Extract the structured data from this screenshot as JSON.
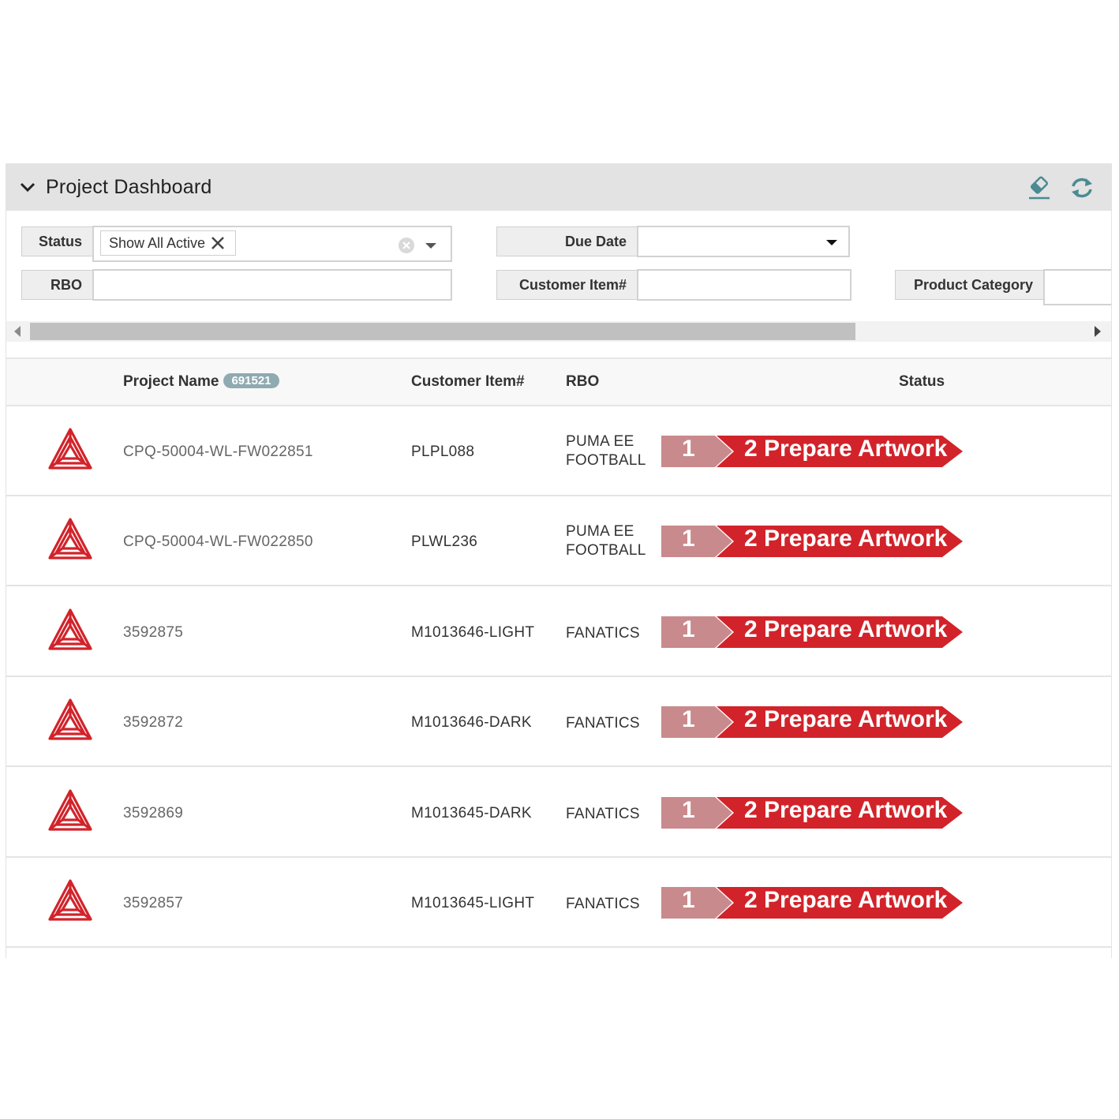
{
  "panel": {
    "title": "Project Dashboard",
    "icons": [
      "chevron-down-icon",
      "eraser-icon",
      "refresh-icon"
    ]
  },
  "filters": {
    "status_label": "Status",
    "status_tag": "Show All Active",
    "due_date_label": "Due Date",
    "due_date_value": "",
    "rbo_label": "RBO",
    "rbo_value": "",
    "customer_item_label": "Customer Item#",
    "customer_item_value": "",
    "product_category_label": "Product Category",
    "product_category_value": ""
  },
  "table": {
    "columns": {
      "project_name": "Project Name",
      "project_count": "691521",
      "customer_item": "Customer Item#",
      "rbo": "RBO",
      "status": "Status"
    },
    "rows": [
      {
        "name": "CPQ-50004-WL-FW022851",
        "item": "PLPL088",
        "rbo_line1": "PUMA EE",
        "rbo_line2": "FOOTBALL",
        "step1": "1",
        "step2": "2 Prepare Artwork"
      },
      {
        "name": "CPQ-50004-WL-FW022850",
        "item": "PLWL236",
        "rbo_line1": "PUMA EE",
        "rbo_line2": "FOOTBALL",
        "step1": "1",
        "step2": "2 Prepare Artwork"
      },
      {
        "name": "3592875",
        "item": "M1013646-LIGHT",
        "rbo_line1": "FANATICS",
        "rbo_line2": "",
        "step1": "1",
        "step2": "2 Prepare Artwork"
      },
      {
        "name": "3592872",
        "item": "M1013646-DARK",
        "rbo_line1": "FANATICS",
        "rbo_line2": "",
        "step1": "1",
        "step2": "2 Prepare Artwork"
      },
      {
        "name": "3592869",
        "item": "M1013645-DARK",
        "rbo_line1": "FANATICS",
        "rbo_line2": "",
        "step1": "1",
        "step2": "2 Prepare Artwork"
      },
      {
        "name": "3592857",
        "item": "M1013645-LIGHT",
        "rbo_line1": "FANATICS",
        "rbo_line2": "",
        "step1": "1",
        "step2": "2 Prepare Artwork"
      }
    ]
  },
  "colors": {
    "header_bg": "#e2e3e2",
    "step_done": "#c98a8d",
    "step_active": "#d2232a",
    "logo_red": "#d2232a"
  }
}
